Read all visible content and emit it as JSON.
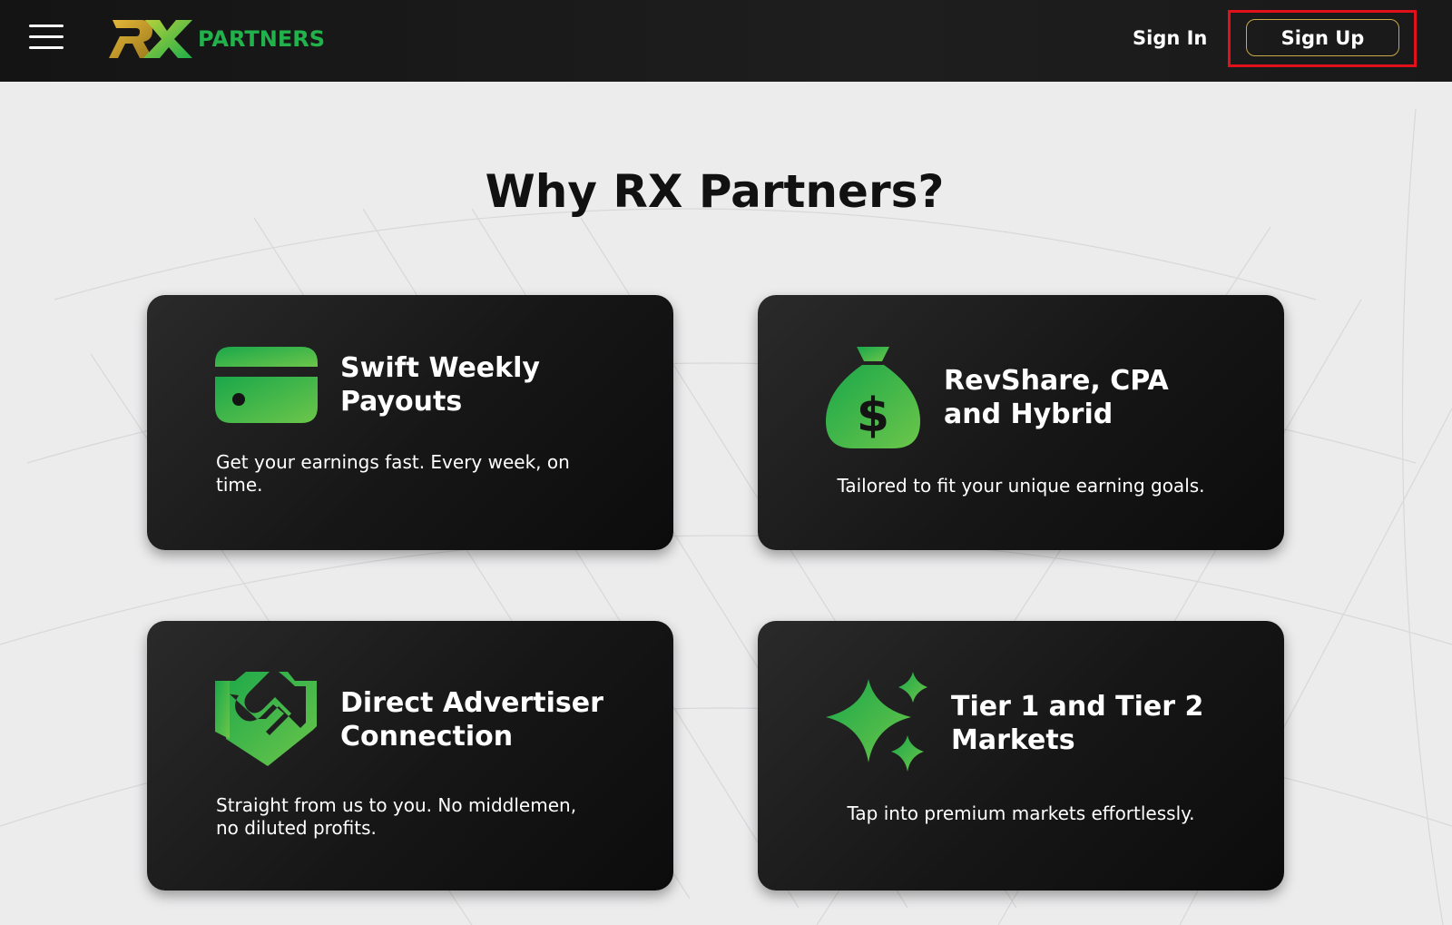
{
  "header": {
    "logo_text": "PARTNERS",
    "sign_in_label": "Sign In",
    "sign_up_label": "Sign Up"
  },
  "main": {
    "heading": "Why RX Partners?",
    "cards": [
      {
        "title_line1": "Swift Weekly",
        "title_line2": "Payouts",
        "description": "Get your earnings fast. Every week, on time.",
        "icon": "credit-card-icon"
      },
      {
        "title_line1": "RevShare, CPA",
        "title_line2": "and Hybrid",
        "description": "Tailored to fit your unique earning goals.",
        "icon": "money-bag-icon"
      },
      {
        "title_line1": "Direct Advertiser",
        "title_line2": "Connection",
        "description": "Straight from us to you. No middlemen, no diluted profits.",
        "icon": "handshake-icon"
      },
      {
        "title_line1": "Tier 1 and Tier 2",
        "title_line2": "Markets",
        "description": "Tap into premium markets effortlessly.",
        "icon": "sparkles-icon"
      }
    ]
  },
  "colors": {
    "accent_green": "#22b24c",
    "gold": "#c6a94a",
    "highlight_red": "#e0111a"
  }
}
